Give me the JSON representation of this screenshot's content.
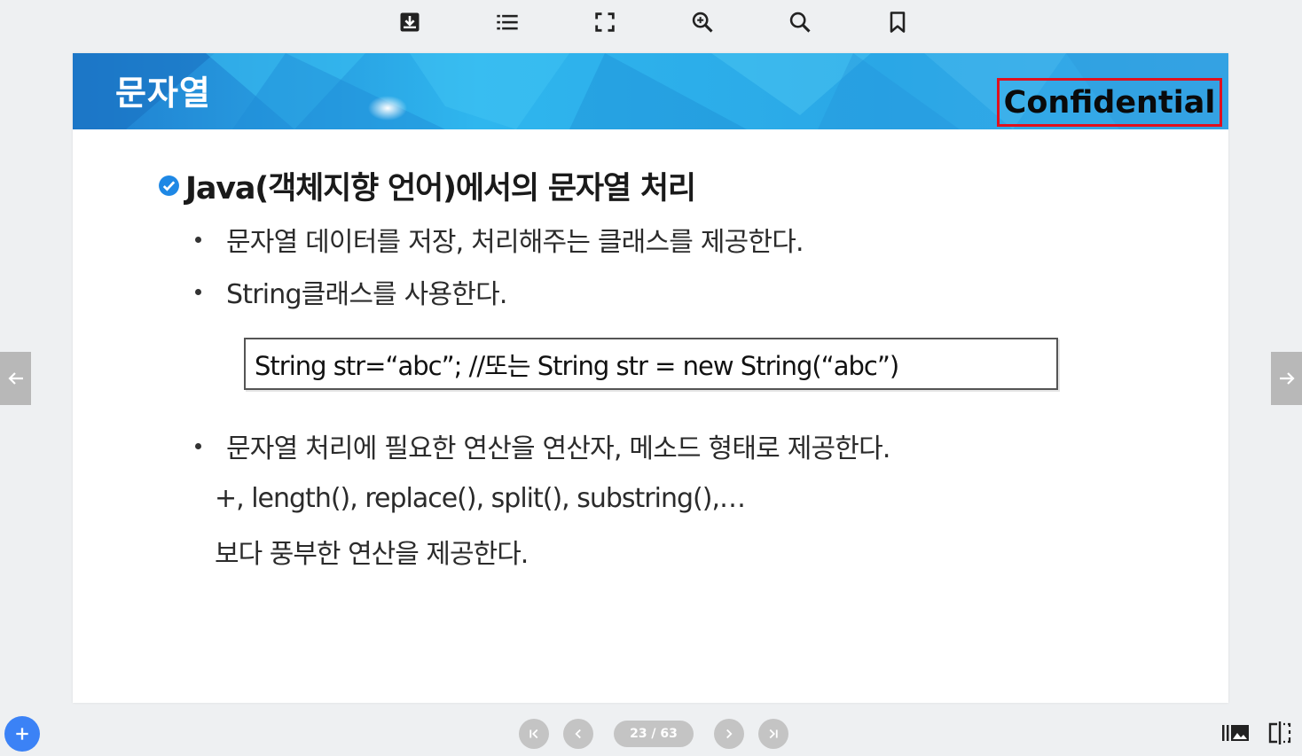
{
  "toolbar": {
    "icons": [
      "download-icon",
      "list-icon",
      "fullscreen-icon",
      "zoom-in-icon",
      "search-icon",
      "bookmark-icon"
    ]
  },
  "slide": {
    "banner_title": "문자열",
    "confidential": "Confidential",
    "heading": "Java(객체지향 언어)에서의 문자열 처리",
    "bullets": [
      "문자열 데이터를 저장, 처리해주는 클래스를 제공한다.",
      "String클래스를 사용한다.",
      "문자열 처리에 필요한 연산을 연산자, 메소드 형태로 제공한다."
    ],
    "code": "String str=“abc”; //또는 String str = new String(“abc”)",
    "line_methods": "+, length(), replace(), split(), substring(),…",
    "line_rich": "보다 풍부한 연산을 제공한다.",
    "colors": {
      "banner": "#2aa7e6",
      "confidential_border": "#e0101e",
      "check": "#1e88e5"
    }
  },
  "pager": {
    "label": "23 / 63",
    "current": 23,
    "total": 63
  },
  "colors": {
    "fab": "#3b82f6",
    "nav": "#c4c4c4",
    "side_arrow": "#b8b8b8"
  }
}
